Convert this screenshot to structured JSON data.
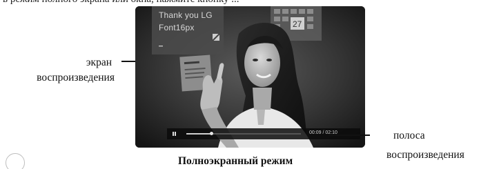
{
  "header": {
    "partial_text": "в режим полного экрана или окна, нажмите кнопку ..."
  },
  "screen_overlay": {
    "line1": "Thank you LG",
    "line2": "Font16px"
  },
  "playback": {
    "time": "00:09 / 02:10",
    "progress": 0.22
  },
  "callouts": {
    "screen_line1": "экран",
    "screen_line2": "воспроизведения",
    "bar_line1": "полоса",
    "bar_line2": "воспроизведения"
  },
  "caption": "Полноэкранный режим"
}
